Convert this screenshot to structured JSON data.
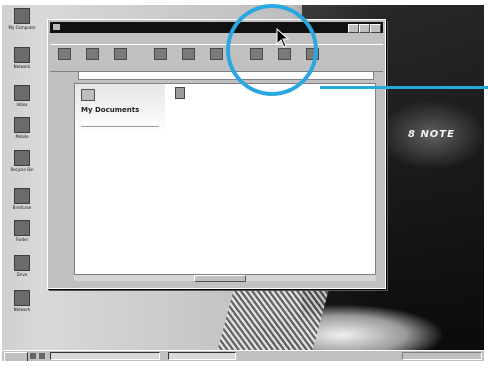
{
  "desktop": {
    "icons": [
      {
        "name": "my-computer-icon",
        "label": "My Computer"
      },
      {
        "name": "network-icon",
        "label": "Network"
      },
      {
        "name": "inbox-icon",
        "label": "Inbox"
      },
      {
        "name": "mobile-icon",
        "label": "Mobile"
      },
      {
        "name": "recycle-bin-icon",
        "label": "Recycle Bin"
      },
      {
        "name": "briefcase-icon",
        "label": "Briefcase"
      },
      {
        "name": "folder-icon",
        "label": "Folder"
      },
      {
        "name": "drive-icon",
        "label": "Drive"
      },
      {
        "name": "network-folder-icon",
        "label": "Network"
      }
    ],
    "wallpaper_title": "8 NOTE"
  },
  "window": {
    "title": "",
    "menu": [
      "",
      "",
      "",
      "",
      "",
      ""
    ],
    "toolbar": [
      "",
      "",
      "",
      "",
      "",
      "",
      "",
      "",
      ""
    ],
    "address_label": "",
    "address_value": "",
    "folder_name": "My Documents",
    "folder_description": "",
    "file_label": "",
    "status": ""
  },
  "taskbar": {
    "start_label": "",
    "tasks": [
      "",
      ""
    ],
    "tray_text": ""
  },
  "colors": {
    "callout": "#2aa7e0",
    "title_bar": "#111111",
    "window_face": "#c0c0c0"
  }
}
